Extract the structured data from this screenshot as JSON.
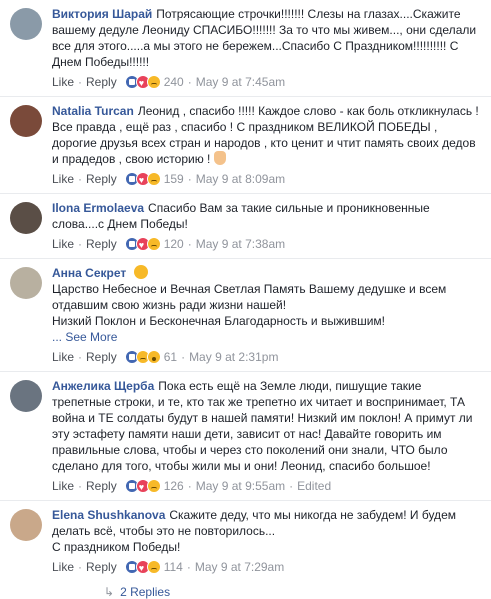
{
  "footer_labels": {
    "like": "Like",
    "reply": "Reply",
    "sep": "·"
  },
  "comments": [
    {
      "author": "Виктория Шарай",
      "text": "Потрясающие строчки!!!!!!! Слезы на глазах....Скажите вашему дедуле Леониду СПАСИБО!!!!!!! За то что мы живем..., они сделали все для этого.....а мы этого не бережем...Спасибо С Праздником!!!!!!!!!! С Днем Победы!!!!!!",
      "reactions": [
        "like",
        "love",
        "sad"
      ],
      "count": "240",
      "time": "May 9 at 7:45am",
      "avatar_color": "#8a9aa8"
    },
    {
      "author": "Natalia Turcan",
      "text": "Леонид , спасибо !!!!! Каждое слово - как боль откликнулась ! Все правда , ещё раз , спасибо ! С праздником ВЕЛИКОЙ ПОБЕДЫ , дорогие друзья всех стран и народов , кто ценит и чтит память своих дедов и прадедов , свою историю !",
      "reactions": [
        "like",
        "love",
        "sad"
      ],
      "count": "159",
      "time": "May 9 at 8:09am",
      "avatar_color": "#7a4a3a"
    },
    {
      "author": "Ilona Ermolaeva",
      "text": "Спасибо Вам за такие сильные и проникновенные слова....с Днем Победы!",
      "reactions": [
        "like",
        "love",
        "sad"
      ],
      "count": "120",
      "time": "May 9 at 7:38am",
      "avatar_color": "#5a4e46"
    },
    {
      "author": "Анна Секрет",
      "text_lines": [
        "Царство Небесное и Вечная Светлая Память Вашему дедушке и всем отдавшим свою жизнь ради жизни нашей!",
        "Низкий Поклон и Бесконечная Благодарность и выжившим!"
      ],
      "see_more": "... See More",
      "reactions": [
        "like",
        "sad",
        "wow"
      ],
      "count": "61",
      "time": "May 9 at 2:31pm",
      "avatar_color": "#b8b0a0"
    },
    {
      "author": "Анжелика Щерба",
      "text": "Пока есть ещё на Земле люди, пишущие такие трепетные строки, и те, кто так же трепетно их читает и воспринимает, ТА война и ТЕ солдаты будут в нашей памяти! Низкий им поклон! А примут ли эту эстафету памяти наши дети, зависит от нас! Давайте говорить им правильные слова, чтобы и через сто поколений они знали, ЧТО было сделано для того, чтобы жили мы и они! Леонид, спасибо большое!",
      "reactions": [
        "like",
        "love",
        "sad"
      ],
      "count": "126",
      "time": "May 9 at 9:55am",
      "edited": "Edited",
      "avatar_color": "#6a7480"
    },
    {
      "author": "Elena Shushkanova",
      "text_lines": [
        "Скажите деду, что мы никогда не забудем! И будем делать всё, чтобы это не повторилось...",
        "С праздником Победы!"
      ],
      "reactions": [
        "like",
        "love",
        "sad"
      ],
      "count": "114",
      "time": "May 9 at 7:29am",
      "avatar_color": "#c9a88a"
    }
  ],
  "replies": {
    "label": "2 Replies"
  }
}
